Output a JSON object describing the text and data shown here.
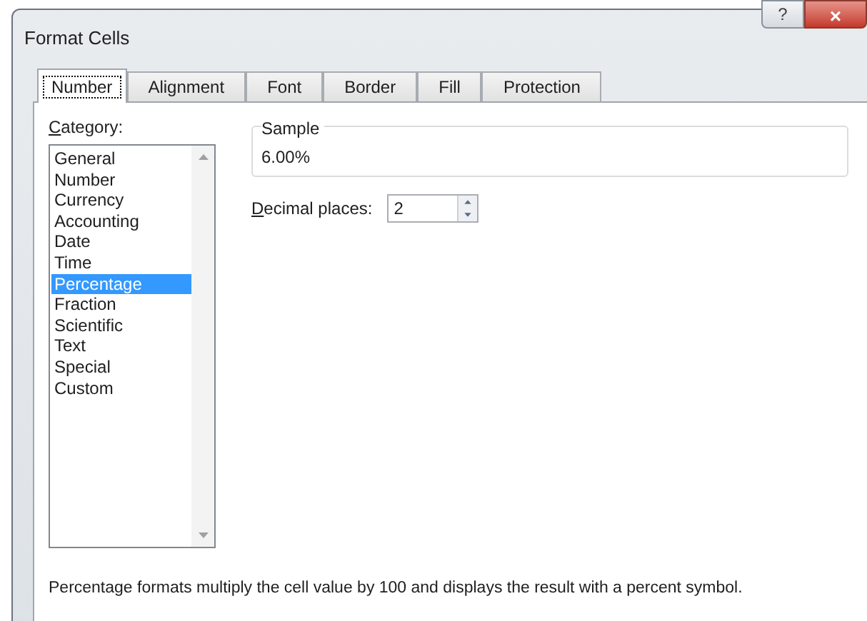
{
  "window": {
    "title": "Format Cells",
    "title_buttons": [
      "?",
      "×"
    ]
  },
  "tabs": [
    {
      "label": "Number",
      "selected": true
    },
    {
      "label": "Alignment",
      "selected": false
    },
    {
      "label": "Font",
      "selected": false
    },
    {
      "label": "Border",
      "selected": false
    },
    {
      "label": "Fill",
      "selected": false
    },
    {
      "label": "Protection",
      "selected": false
    }
  ],
  "category": {
    "label": "Category:",
    "items": [
      {
        "label": "General",
        "selected": false
      },
      {
        "label": "Number",
        "selected": false
      },
      {
        "label": "Currency",
        "selected": false
      },
      {
        "label": "Accounting",
        "selected": false
      },
      {
        "label": "Date",
        "selected": false
      },
      {
        "label": "Time",
        "selected": false
      },
      {
        "label": "Percentage",
        "selected": true
      },
      {
        "label": "Fraction",
        "selected": false
      },
      {
        "label": "Scientific",
        "selected": false
      },
      {
        "label": "Text",
        "selected": false
      },
      {
        "label": "Special",
        "selected": false
      },
      {
        "label": "Custom",
        "selected": false
      }
    ]
  },
  "sample": {
    "label": "Sample",
    "value": "6.00%"
  },
  "decimal_places": {
    "label": "Decimal places:",
    "value": "2"
  },
  "description": "Percentage formats multiply the cell value by 100 and displays the result with a percent symbol."
}
